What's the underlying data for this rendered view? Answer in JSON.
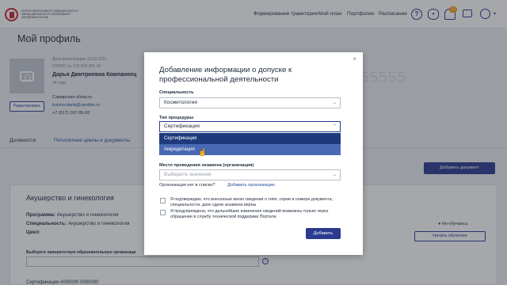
{
  "logo": {
    "text": "Портал непрерывного медицинского и фармацевтического образования Минздрава России"
  },
  "nav": {
    "trajectory": "Формирование траектории",
    "plan": "Мой план",
    "portfolio": "Портфолио",
    "schedule": "Расписание"
  },
  "header_icons": {
    "help": "question-icon",
    "view": "eye-icon",
    "notifications": "bell-icon",
    "notifications_count": "15",
    "chat": "chat-icon",
    "user": "user-icon"
  },
  "profile": {
    "title": "Мой профиль",
    "reg_date": "Дата регистрации: 23.02.2021",
    "snils": "СНИЛС № 179-579-201 34",
    "name": "Дарья Дмитриевна Компанеец",
    "age": "34 года",
    "edit": "Редактировать",
    "region": "Самарская область",
    "email": "kuzina-daria@rambler.ru",
    "phone": "+7 (917) 167-95-93",
    "bg_number": "55555"
  },
  "tabs": [
    "Должности",
    "Пятилетние циклы и документы"
  ],
  "add_document": "Добавить документ",
  "card": {
    "title": "Акушерство и гинекология",
    "program_label": "Программа:",
    "program_value": "Акушерство и гинекология",
    "spec_label": "Специальность:",
    "spec_value": "Акушерство и гинекология",
    "cycle_label": "Цикл:",
    "status": "Не обучаюсь",
    "start_btn": "Начать обучение",
    "org_label": "Выберите приоритетную образовательную организаци",
    "cert_line": "Сертификация   #000000 0000000"
  },
  "modal": {
    "close": "×",
    "title": "Добавление информации о допуске к профессиональной деятельности",
    "spec_label": "Специальность",
    "spec_value": "Косметология",
    "proc_label": "Тип процедуры",
    "proc_value": "Сертификация",
    "options": [
      "Сертификация",
      "Аккредитация"
    ],
    "place_label": "Место проведения экзамена (организация)",
    "place_placeholder": "Выберите значение",
    "org_question": "Организации нет в списке?",
    "add_org": "Добавить организацию",
    "check1": "Я подтверждаю, что внесенные мною сведения о типе, серии и номере документа, специальности, дате сдачи экзамена верны",
    "check2": "Я предупреждена, что дальнейшие изменения сведений возможны только через обращение в службу технической поддержки Портала",
    "submit": "Добавить"
  }
}
